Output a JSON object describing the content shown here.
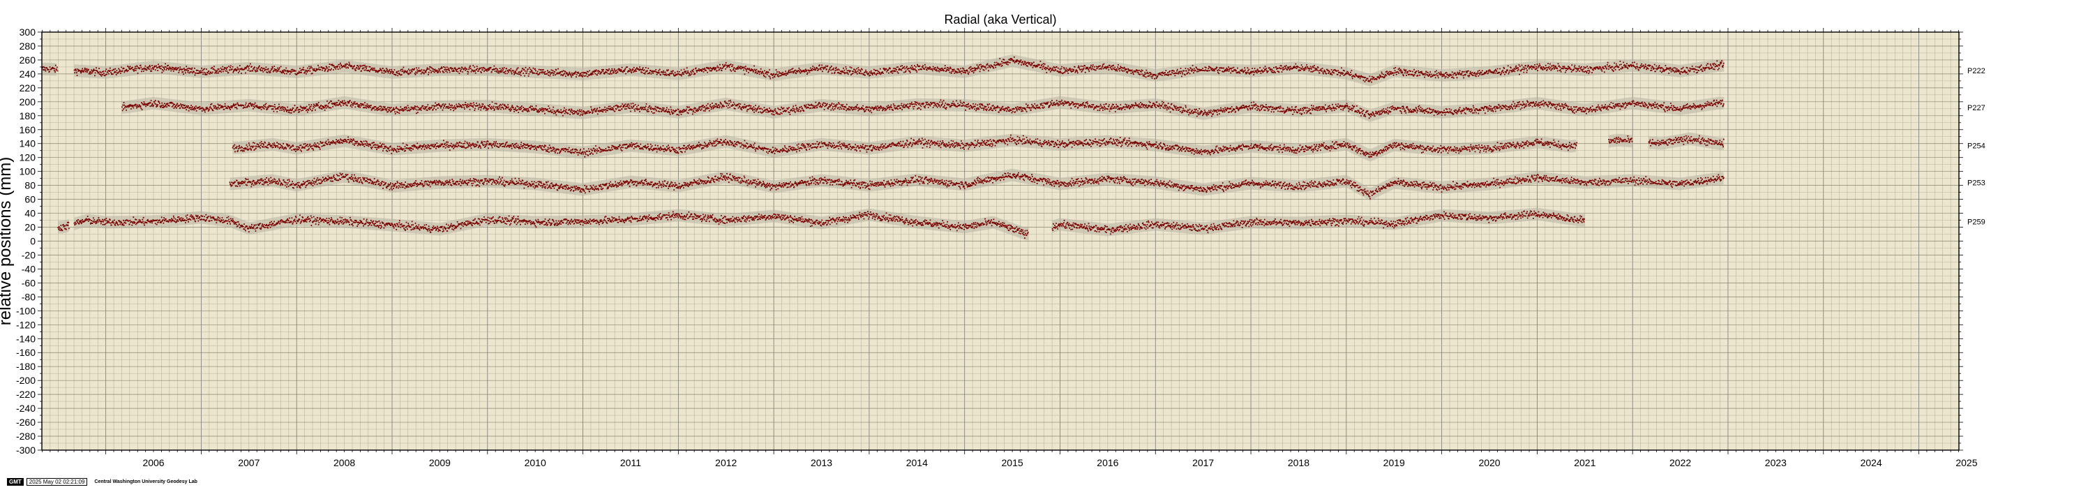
{
  "chart_data": {
    "type": "scatter",
    "title": "Radial (aka Vertical)",
    "ylabel": "relative positions (mm)",
    "xlabel": "",
    "xlim": [
      2005.33,
      2025.42
    ],
    "ylim": [
      -300,
      300
    ],
    "ytick_step": 20,
    "x_ticks": [
      "2006",
      "2007",
      "2008",
      "2009",
      "2010",
      "2011",
      "2012",
      "2013",
      "2014",
      "2015",
      "2016",
      "2017",
      "2018",
      "2019",
      "2020",
      "2021",
      "2022",
      "2023",
      "2024",
      "2025"
    ],
    "grid": true,
    "background_color": "#ece6cf",
    "point_color": "#7a0000",
    "series": [
      {
        "name": "P222",
        "offset": 245,
        "segments": [
          [
            2005.33,
            2005.5
          ],
          [
            2005.67,
            2022.96
          ]
        ],
        "x": [
          2005.4,
          2006.0,
          2006.5,
          2007.0,
          2007.5,
          2008.0,
          2008.5,
          2009.0,
          2009.5,
          2010.0,
          2010.5,
          2011.0,
          2011.5,
          2012.0,
          2012.5,
          2013.0,
          2013.5,
          2014.0,
          2014.5,
          2015.0,
          2015.5,
          2016.0,
          2016.5,
          2017.0,
          2017.5,
          2018.0,
          2018.5,
          2019.0,
          2019.25,
          2019.5,
          2020.0,
          2020.5,
          2021.0,
          2021.5,
          2022.0,
          2022.5,
          2022.9
        ],
        "y": [
          247,
          242,
          250,
          243,
          248,
          243,
          251,
          242,
          246,
          246,
          243,
          240,
          246,
          240,
          251,
          239,
          248,
          242,
          249,
          243,
          259,
          245,
          250,
          238,
          247,
          244,
          249,
          241,
          231,
          244,
          238,
          242,
          250,
          246,
          252,
          244,
          252
        ]
      },
      {
        "name": "P227",
        "offset": 192,
        "segments": [
          [
            2006.17,
            2022.96
          ]
        ],
        "x": [
          2006.2,
          2006.5,
          2007.0,
          2007.5,
          2008.0,
          2008.5,
          2009.0,
          2009.5,
          2010.0,
          2010.5,
          2011.0,
          2011.5,
          2012.0,
          2012.5,
          2013.0,
          2013.5,
          2014.0,
          2014.5,
          2015.0,
          2015.5,
          2016.0,
          2016.5,
          2017.0,
          2017.5,
          2018.0,
          2018.5,
          2019.0,
          2019.25,
          2019.5,
          2020.0,
          2020.5,
          2021.0,
          2021.5,
          2022.0,
          2022.5,
          2022.9
        ],
        "y": [
          192,
          198,
          190,
          195,
          188,
          199,
          188,
          193,
          194,
          189,
          184,
          193,
          185,
          197,
          185,
          195,
          189,
          196,
          195,
          188,
          199,
          191,
          196,
          183,
          193,
          187,
          194,
          180,
          191,
          185,
          190,
          198,
          188,
          198,
          190,
          198
        ]
      },
      {
        "name": "P254",
        "offset": 137,
        "segments": [
          [
            2007.33,
            2021.42
          ],
          [
            2021.75,
            2022.0
          ],
          [
            2022.17,
            2022.96
          ]
        ],
        "x": [
          2007.4,
          2007.75,
          2008.0,
          2008.5,
          2009.0,
          2009.5,
          2010.0,
          2010.5,
          2011.0,
          2011.5,
          2012.0,
          2012.5,
          2013.0,
          2013.5,
          2014.0,
          2014.5,
          2015.0,
          2015.5,
          2016.0,
          2016.5,
          2017.0,
          2017.5,
          2018.0,
          2018.5,
          2019.0,
          2019.25,
          2019.5,
          2020.0,
          2020.5,
          2021.0,
          2021.35,
          2021.85,
          2022.3,
          2022.6,
          2022.9
        ],
        "y": [
          134,
          139,
          133,
          144,
          132,
          137,
          139,
          135,
          127,
          137,
          131,
          143,
          129,
          139,
          133,
          142,
          137,
          145,
          139,
          143,
          138,
          128,
          136,
          131,
          139,
          123,
          138,
          131,
          134,
          142,
          136,
          145,
          140,
          147,
          140
        ]
      },
      {
        "name": "P253",
        "offset": 84,
        "segments": [
          [
            2007.3,
            2022.96
          ]
        ],
        "x": [
          2007.3,
          2007.75,
          2008.0,
          2008.5,
          2009.0,
          2009.5,
          2010.0,
          2010.5,
          2011.0,
          2011.5,
          2012.0,
          2012.5,
          2013.0,
          2013.5,
          2014.0,
          2014.5,
          2015.0,
          2015.5,
          2016.0,
          2016.5,
          2017.0,
          2017.5,
          2018.0,
          2018.5,
          2019.0,
          2019.25,
          2019.5,
          2020.0,
          2020.5,
          2021.0,
          2021.5,
          2022.0,
          2022.5,
          2022.9
        ],
        "y": [
          82,
          87,
          80,
          93,
          79,
          84,
          86,
          82,
          74,
          85,
          79,
          92,
          78,
          87,
          80,
          88,
          81,
          95,
          82,
          89,
          84,
          74,
          83,
          79,
          86,
          67,
          84,
          77,
          82,
          91,
          84,
          87,
          82,
          90
        ]
      },
      {
        "name": "P259",
        "offset": 28,
        "segments": [
          [
            2005.5,
            2005.62
          ],
          [
            2005.67,
            2015.67
          ],
          [
            2015.92,
            2021.5
          ]
        ],
        "x": [
          2005.55,
          2005.8,
          2006.0,
          2006.5,
          2007.0,
          2007.3,
          2007.5,
          2008.0,
          2008.5,
          2009.0,
          2009.5,
          2010.0,
          2010.5,
          2011.0,
          2011.5,
          2012.0,
          2012.5,
          2013.0,
          2013.5,
          2014.0,
          2014.5,
          2015.0,
          2015.3,
          2015.65,
          2016.0,
          2016.5,
          2017.0,
          2017.5,
          2018.0,
          2018.5,
          2019.0,
          2019.5,
          2020.0,
          2020.5,
          2021.0,
          2021.45
        ],
        "y": [
          20,
          30,
          27,
          28,
          34,
          29,
          18,
          31,
          28,
          23,
          17,
          31,
          27,
          28,
          31,
          37,
          30,
          36,
          26,
          38,
          27,
          20,
          27,
          10,
          24,
          16,
          24,
          18,
          27,
          26,
          29,
          25,
          37,
          33,
          39,
          30
        ]
      }
    ]
  },
  "footer": {
    "logo": "GMT",
    "timestamp": "2025 May 02 02:21:09",
    "credit": "Central Washington University Geodesy Lab"
  }
}
